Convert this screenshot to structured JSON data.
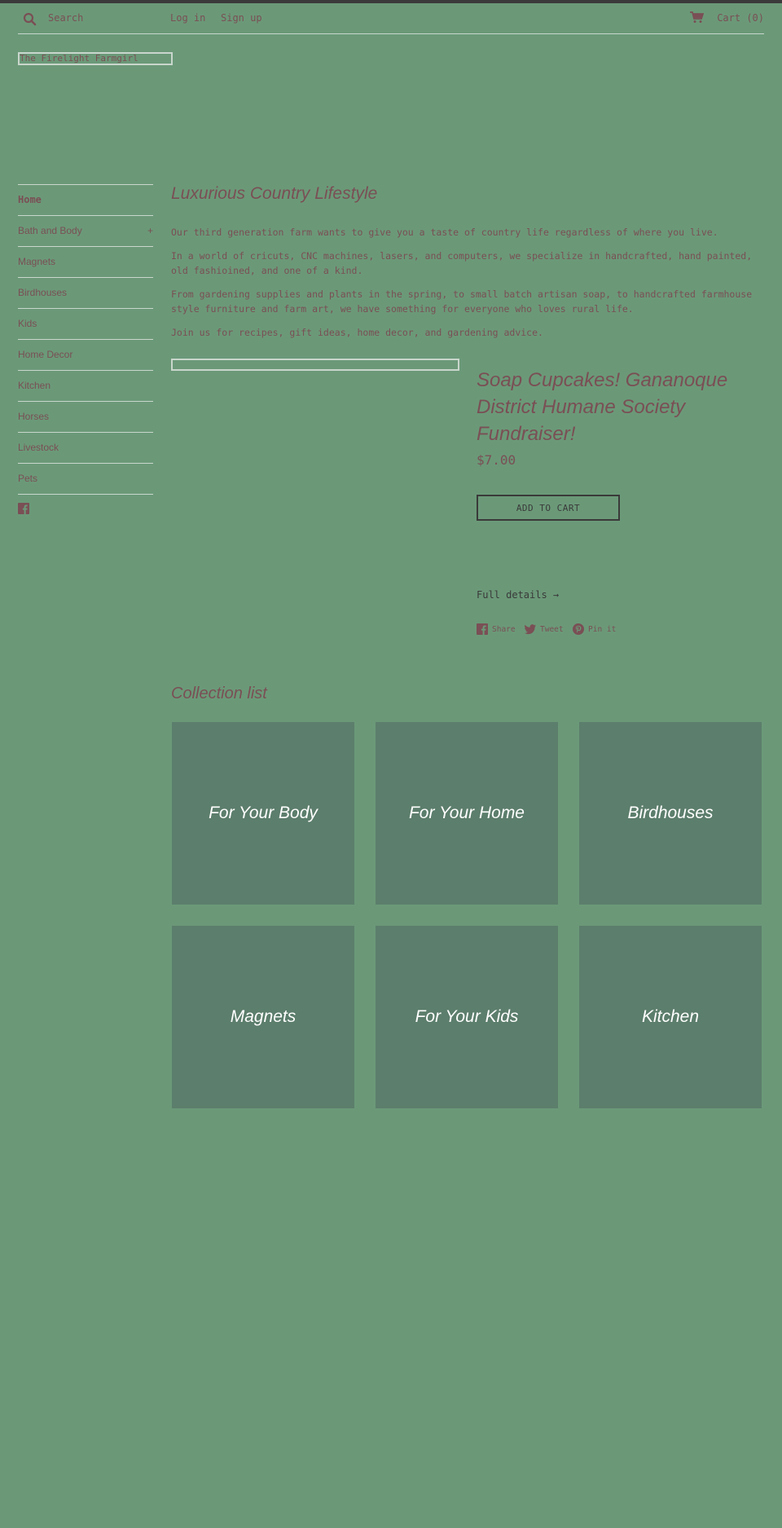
{
  "header": {
    "search_placeholder": "Search",
    "login_label": "Log in",
    "signup_label": "Sign up",
    "cart_label": "Cart (0)"
  },
  "shop": {
    "logo_text": "The Firelight Farmgirl"
  },
  "sidebar": {
    "items": [
      {
        "label": "Home",
        "active": true
      },
      {
        "label": "Bath and Body",
        "has_children": true,
        "toggle": "+"
      },
      {
        "label": "Magnets"
      },
      {
        "label": "Birdhouses"
      },
      {
        "label": "Kids"
      },
      {
        "label": "Home Decor"
      },
      {
        "label": "Kitchen"
      },
      {
        "label": "Horses"
      },
      {
        "label": "Livestock"
      },
      {
        "label": "Pets"
      }
    ],
    "social_icon": "facebook-icon"
  },
  "intro": {
    "title": "Luxurious Country Lifestyle",
    "paragraphs": [
      "Our third generation farm wants to give you a taste of country life regardless of where you live.",
      "In a world of cricuts, CNC machines, lasers, and computers, we specialize in handcrafted, hand painted, old fashioined, and one of a kind.",
      "From gardening supplies and plants in the spring, to small batch artisan soap, to handcrafted farmhouse style furniture and farm art, we have something for everyone who loves rural life.",
      "Join us for recipes, gift ideas, home decor, and gardening advice."
    ]
  },
  "product": {
    "title": "Soap Cupcakes! Gananoque District Humane Society Fundraiser!",
    "price": "$7.00",
    "add_to_cart": "ADD TO CART",
    "full_details": "Full details →",
    "share": [
      {
        "icon": "facebook-icon",
        "label": "Share"
      },
      {
        "icon": "twitter-icon",
        "label": "Tweet"
      },
      {
        "icon": "pinterest-icon",
        "label": "Pin it"
      }
    ]
  },
  "collections": {
    "title": "Collection list",
    "items": [
      "For Your Body",
      "For Your Home",
      "Birdhouses",
      "Magnets",
      "For Your Kids",
      "Kitchen"
    ]
  },
  "colors": {
    "background": "#6b9978",
    "text": "#7a4f55",
    "tile": "#5c7e6c",
    "dark": "#3a3a3a",
    "border": "#c9d6cc"
  }
}
